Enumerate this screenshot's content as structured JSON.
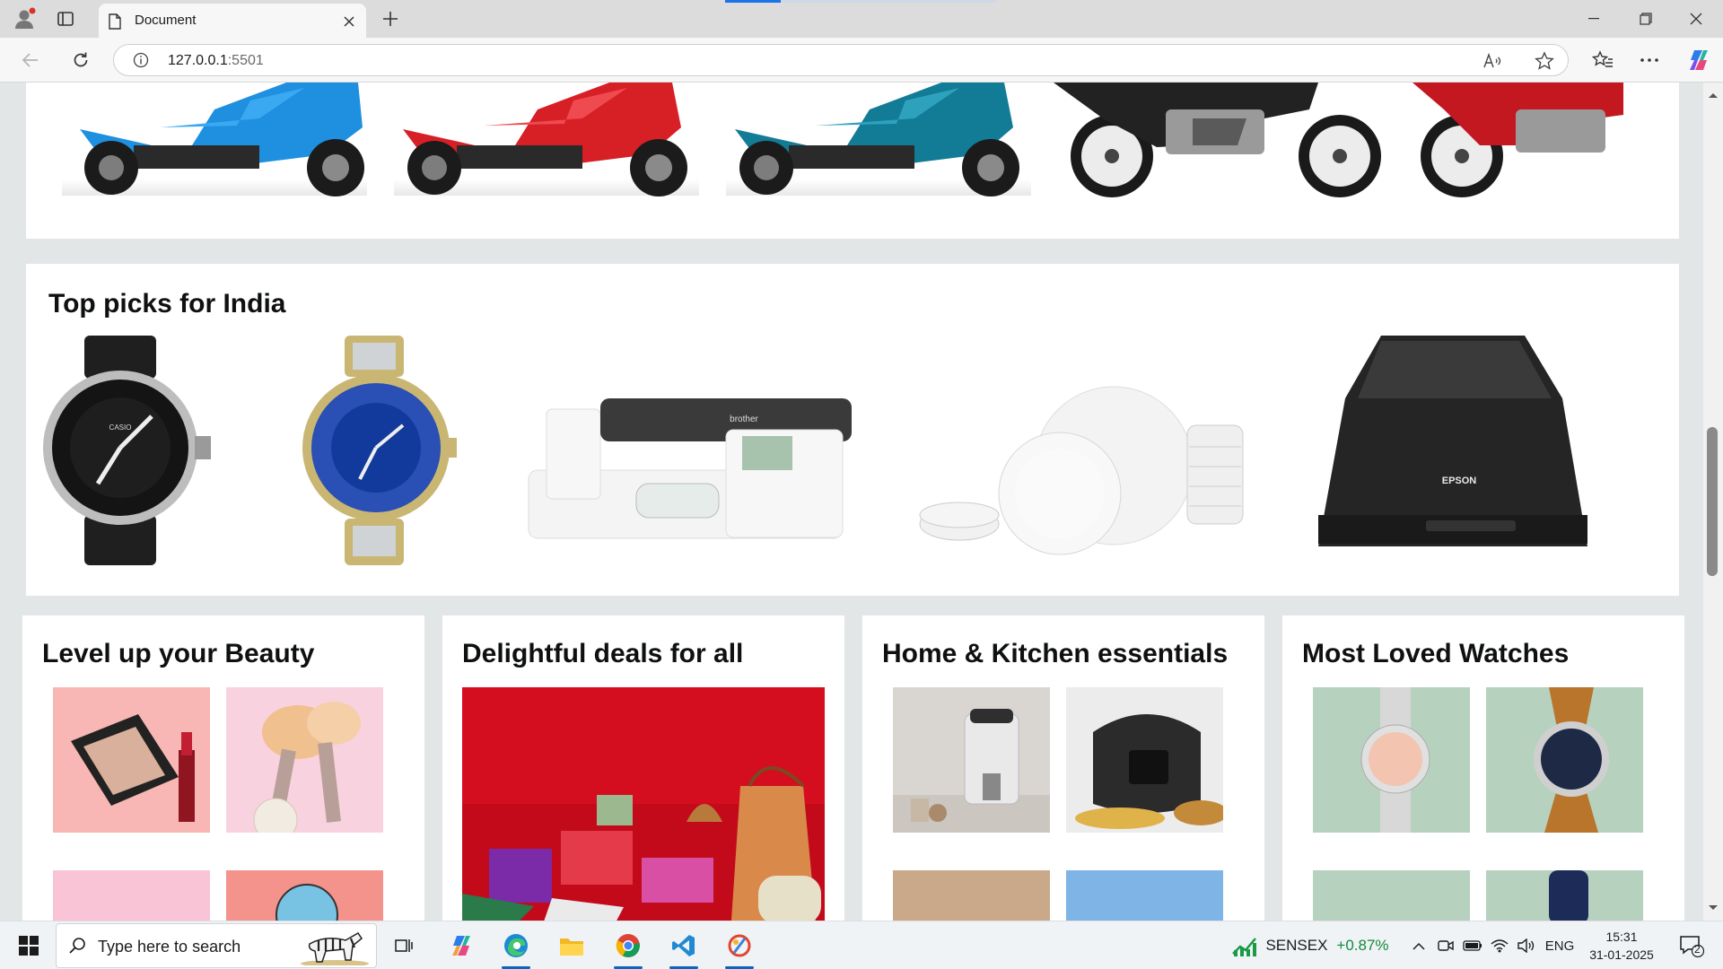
{
  "browser": {
    "tab_title": "Document",
    "url_host": "127.0.0.1",
    "url_port": ":5501",
    "icons": [
      "profile-icon",
      "tab-actions-icon",
      "page-icon",
      "close-tab-icon",
      "new-tab-icon",
      "back-icon",
      "refresh-icon",
      "info-icon",
      "read-aloud-icon",
      "favorite-icon",
      "favorites-icon",
      "more-icon",
      "copilot-icon",
      "minimize-icon",
      "restore-icon",
      "close-window-icon"
    ]
  },
  "page": {
    "vehicles": [
      "blue scooter",
      "red scooter",
      "teal scooter",
      "black motorcycle",
      "red motorcycle"
    ],
    "top_picks": {
      "title": "Top picks for India",
      "items": [
        "Casio diver watch",
        "Invicta two-tone watch",
        "Brother embroidery machine",
        "White dinnerware set",
        "Epson V600 scanner"
      ]
    },
    "cards": [
      {
        "title": "Level up your Beauty"
      },
      {
        "title": "Delightful deals for all"
      },
      {
        "title": "Home & Kitchen essentials"
      },
      {
        "title": "Most Loved Watches"
      }
    ],
    "colors": {
      "page_bg": "#e3e6e6",
      "card_bg": "#ffffff",
      "heading": "#0f1111"
    }
  },
  "taskbar": {
    "search_placeholder": "Type here to search",
    "stock_name": "SENSEX",
    "stock_change": "+0.87%",
    "language": "ENG",
    "time": "15:31",
    "date": "31-01-2025",
    "notifications": "2",
    "pinned_apps": [
      "task-view-icon",
      "copilot-app-icon",
      "edge-icon",
      "file-explorer-icon",
      "chrome-icon",
      "vscode-icon",
      "paint-app-icon"
    ]
  }
}
